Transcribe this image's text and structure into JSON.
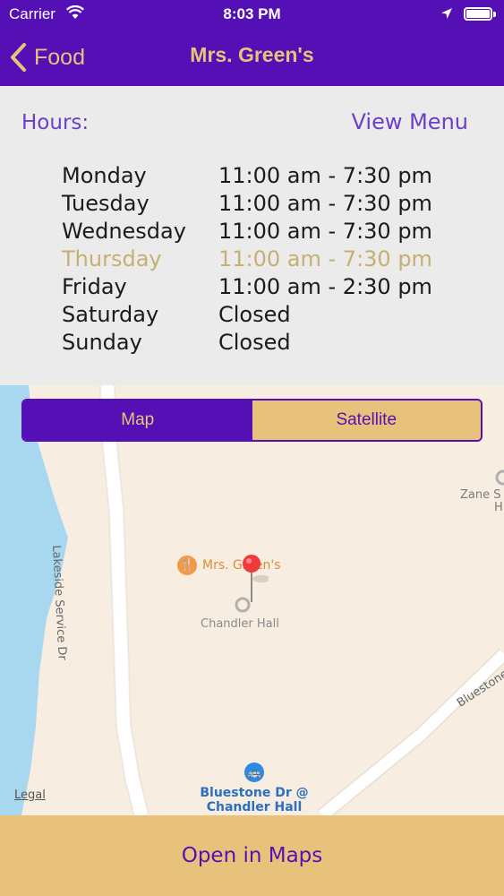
{
  "status_bar": {
    "carrier": "Carrier",
    "time": "8:03 PM"
  },
  "nav": {
    "back_label": "Food",
    "title": "Mrs. Green's"
  },
  "hours_section": {
    "label": "Hours:",
    "view_menu": "View Menu"
  },
  "hours": [
    {
      "day": "Monday",
      "time": "11:00 am - 7:30 pm"
    },
    {
      "day": "Tuesday",
      "time": "11:00 am - 7:30 pm"
    },
    {
      "day": "Wednesday",
      "time": "11:00 am - 7:30 pm"
    },
    {
      "day": "Thursday",
      "time": "11:00 am - 7:30 pm"
    },
    {
      "day": "Friday",
      "time": "11:00 am - 2:30 pm"
    },
    {
      "day": "Saturday",
      "time": "Closed"
    },
    {
      "day": "Sunday",
      "time": "Closed"
    }
  ],
  "highlighted_day": "Thursday",
  "map_type": {
    "options": [
      "Map",
      "Satellite"
    ],
    "selected": "Map"
  },
  "map": {
    "labels": {
      "road_1": "Lakeside Service Dr",
      "road_2": "Bluestone",
      "poi": "Mrs. Green's",
      "building": "Chandler Hall",
      "building_2_line1": "Zane S",
      "building_2_line2": "H",
      "bus_stop_line1": "Bluestone Dr @",
      "bus_stop_line2": "Chandler Hall",
      "legal": "Legal"
    }
  },
  "footer": {
    "open_in_maps": "Open in Maps"
  },
  "colors": {
    "primary": "#5510b5",
    "accent": "#e8c27a",
    "highlight": "#c6b070",
    "water": "#a8d8f0",
    "land": "#f7ede0"
  }
}
